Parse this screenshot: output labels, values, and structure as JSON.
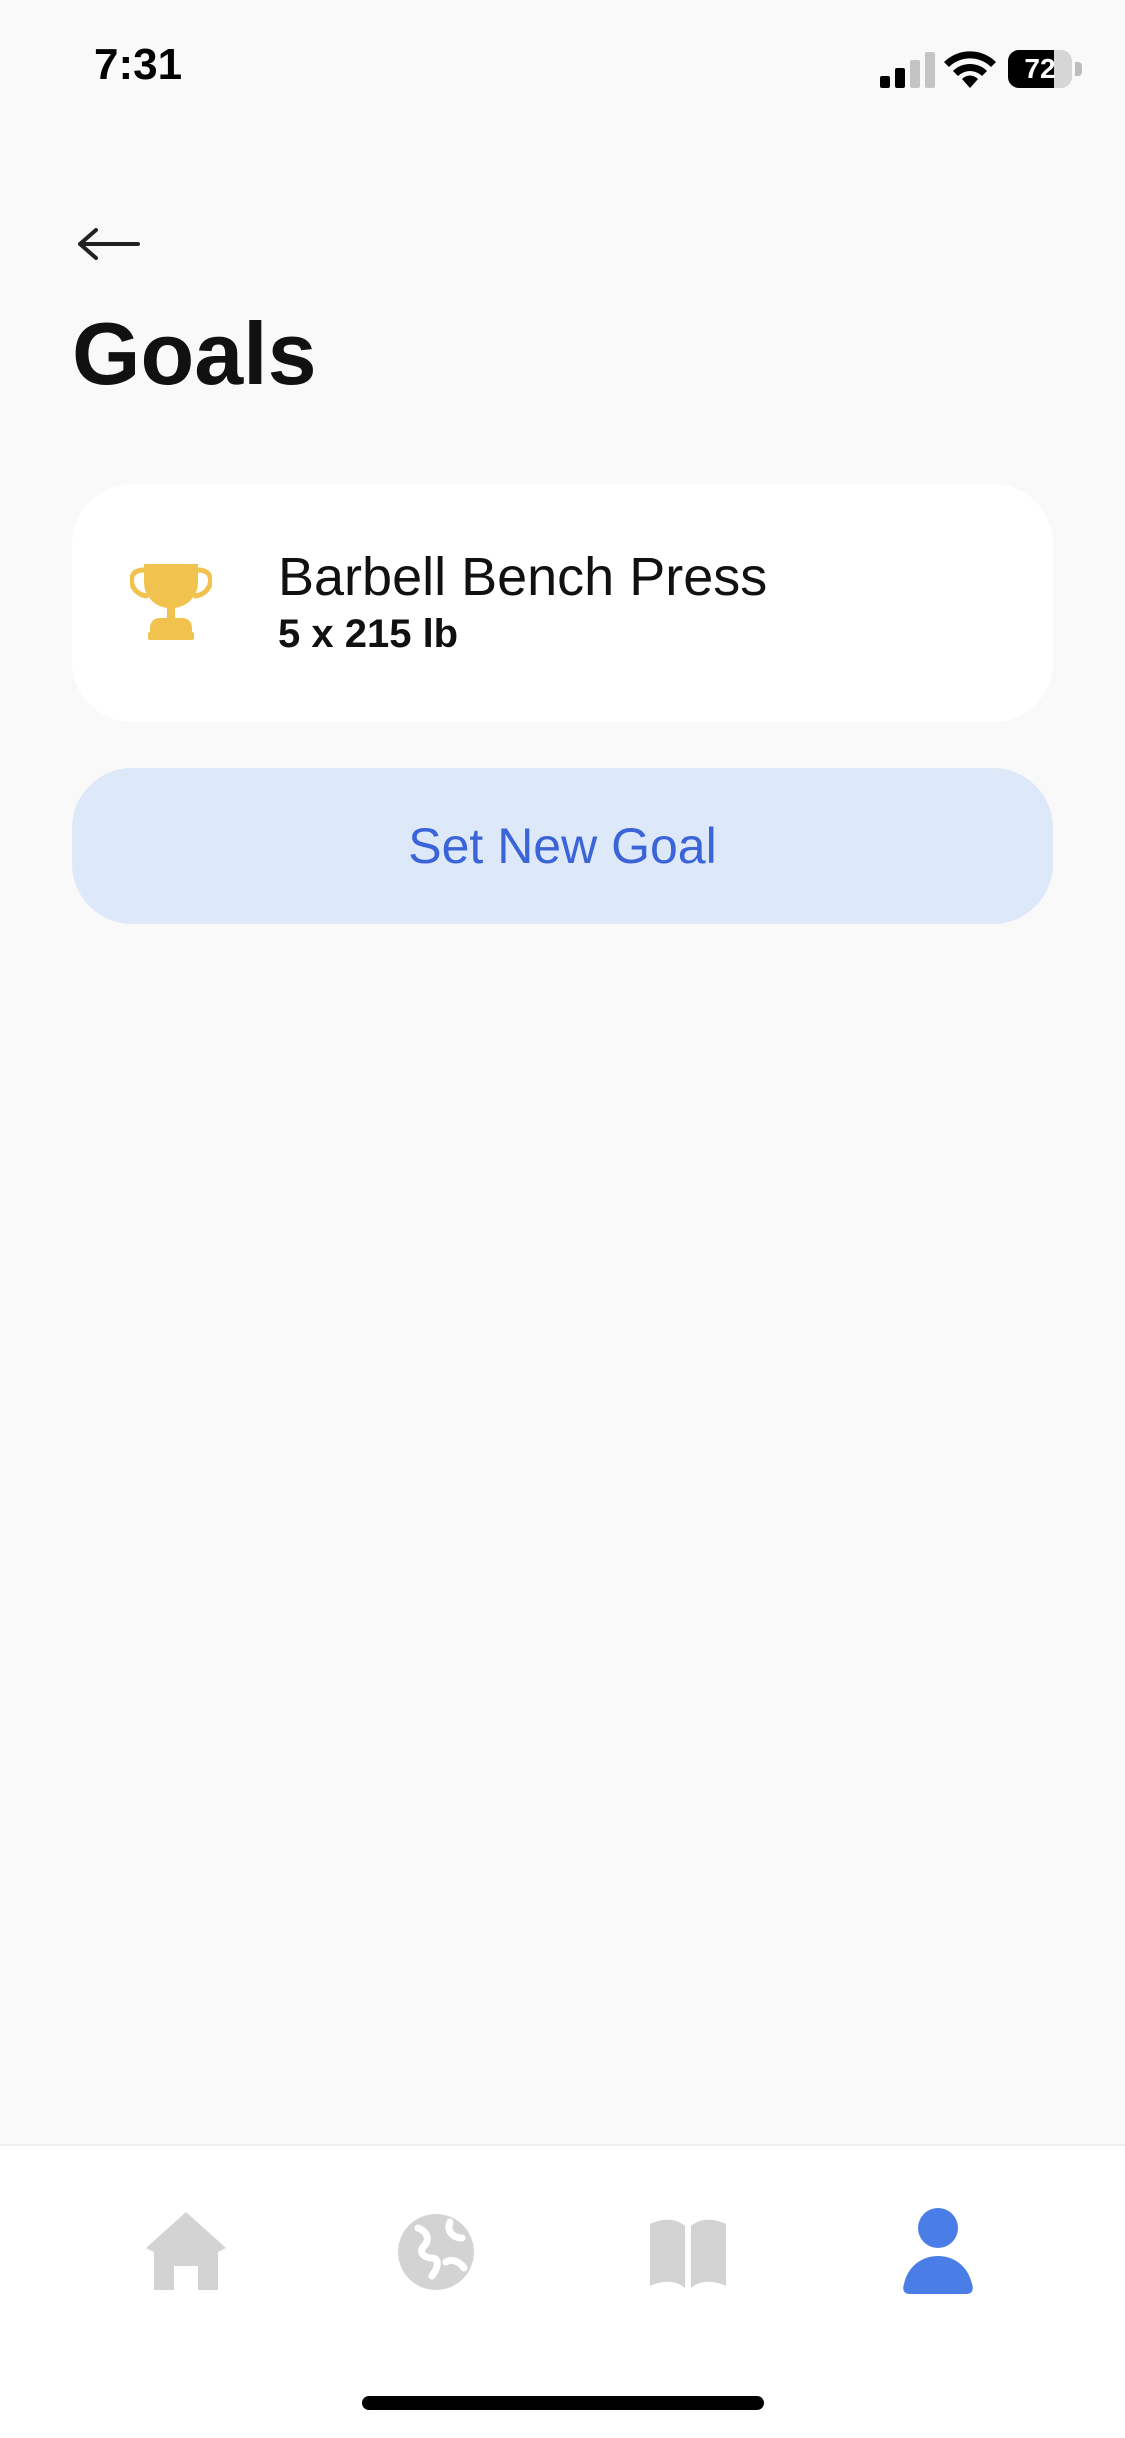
{
  "status_bar": {
    "time": "7:31",
    "battery_level": "72",
    "battery_fraction": 0.72
  },
  "header": {
    "title": "Goals",
    "back_icon": "arrow-left-icon"
  },
  "goals": [
    {
      "icon": "trophy-icon",
      "exercise": "Barbell Bench Press",
      "target": "5 x 215 lb"
    }
  ],
  "actions": {
    "set_new_goal_label": "Set New Goal"
  },
  "tab_bar": {
    "tabs": [
      {
        "icon": "home-icon",
        "active": false
      },
      {
        "icon": "globe-icon",
        "active": false
      },
      {
        "icon": "book-icon",
        "active": false
      },
      {
        "icon": "profile-icon",
        "active": true
      }
    ]
  },
  "colors": {
    "background": "#f9f9f9",
    "card": "#ffffff",
    "accent": "#3b64d8",
    "accent_light": "#dde8f9",
    "trophy": "#f2c24f",
    "tab_inactive": "#d3d3d3",
    "tab_active": "#4a7ee6"
  }
}
